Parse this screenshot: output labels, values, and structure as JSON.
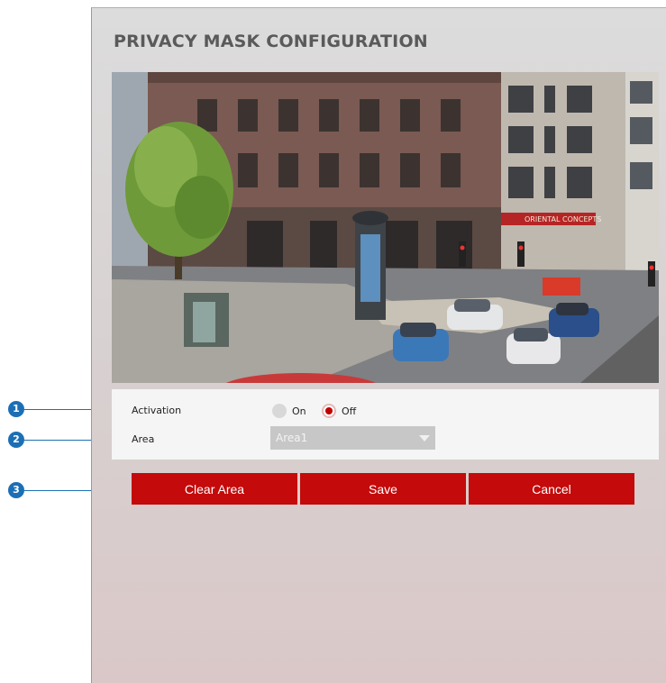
{
  "page": {
    "title": "PRIVACY MASK CONFIGURATION"
  },
  "camera_view": {
    "storefront_sign": "ORIENTAL CONCEPTS"
  },
  "activation": {
    "label": "Activation",
    "options": [
      {
        "label": "On",
        "selected": false
      },
      {
        "label": "Off",
        "selected": true
      }
    ]
  },
  "area": {
    "label": "Area",
    "selected": "Area1"
  },
  "buttons": {
    "clear_area": "Clear Area",
    "save": "Save",
    "cancel": "Cancel"
  },
  "callouts": [
    "1",
    "2",
    "3"
  ],
  "colors": {
    "accent": "#c40a0a",
    "callout": "#1c6fb5"
  }
}
